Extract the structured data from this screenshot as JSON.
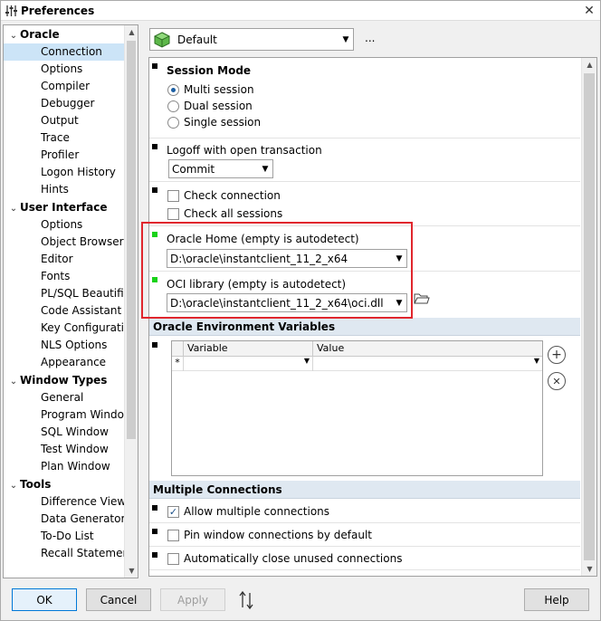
{
  "window": {
    "title": "Preferences",
    "close_glyph": "✕"
  },
  "tree": {
    "groups": [
      {
        "label": "Oracle",
        "items": [
          "Connection",
          "Options",
          "Compiler",
          "Debugger",
          "Output",
          "Trace",
          "Profiler",
          "Logon History",
          "Hints"
        ]
      },
      {
        "label": "User Interface",
        "items": [
          "Options",
          "Object Browser",
          "Editor",
          "Fonts",
          "PL/SQL Beautifier",
          "Code Assistant",
          "Key Configuration",
          "NLS Options",
          "Appearance"
        ]
      },
      {
        "label": "Window Types",
        "items": [
          "General",
          "Program Window",
          "SQL Window",
          "Test Window",
          "Plan Window"
        ]
      },
      {
        "label": "Tools",
        "items": [
          "Difference Viewer",
          "Data Generator",
          "To-Do List",
          "Recall Statement"
        ]
      }
    ],
    "selected": "Connection"
  },
  "profile": {
    "value": "Default",
    "more": "..."
  },
  "session_mode": {
    "title": "Session Mode",
    "options": [
      "Multi session",
      "Dual session",
      "Single session"
    ],
    "selected": "Multi session"
  },
  "logoff": {
    "label": "Logoff with open transaction",
    "value": "Commit"
  },
  "checks": {
    "check_connection": "Check connection",
    "check_all_sessions": "Check all sessions"
  },
  "oracle_home": {
    "label": "Oracle Home (empty is autodetect)",
    "value": "D:\\oracle\\instantclient_11_2_x64"
  },
  "oci_library": {
    "label": "OCI library (empty is autodetect)",
    "value": "D:\\oracle\\instantclient_11_2_x64\\oci.dll"
  },
  "env_vars": {
    "title": "Oracle Environment Variables",
    "columns": [
      "Variable",
      "Value"
    ],
    "new_row_marker": "*",
    "add_glyph": "+",
    "remove_glyph": "✕"
  },
  "multiple_connections": {
    "title": "Multiple Connections",
    "allow": "Allow multiple connections",
    "allow_checked": true,
    "pin": "Pin window connections by default",
    "auto_close": "Automatically close unused connections"
  },
  "buttons": {
    "ok": "OK",
    "cancel": "Cancel",
    "apply": "Apply",
    "help": "Help"
  },
  "colors": {
    "selection": "#cce4f7",
    "section_band": "#dfe8f1",
    "highlight_box": "#e0262d",
    "changed_marker": "#19d219"
  }
}
